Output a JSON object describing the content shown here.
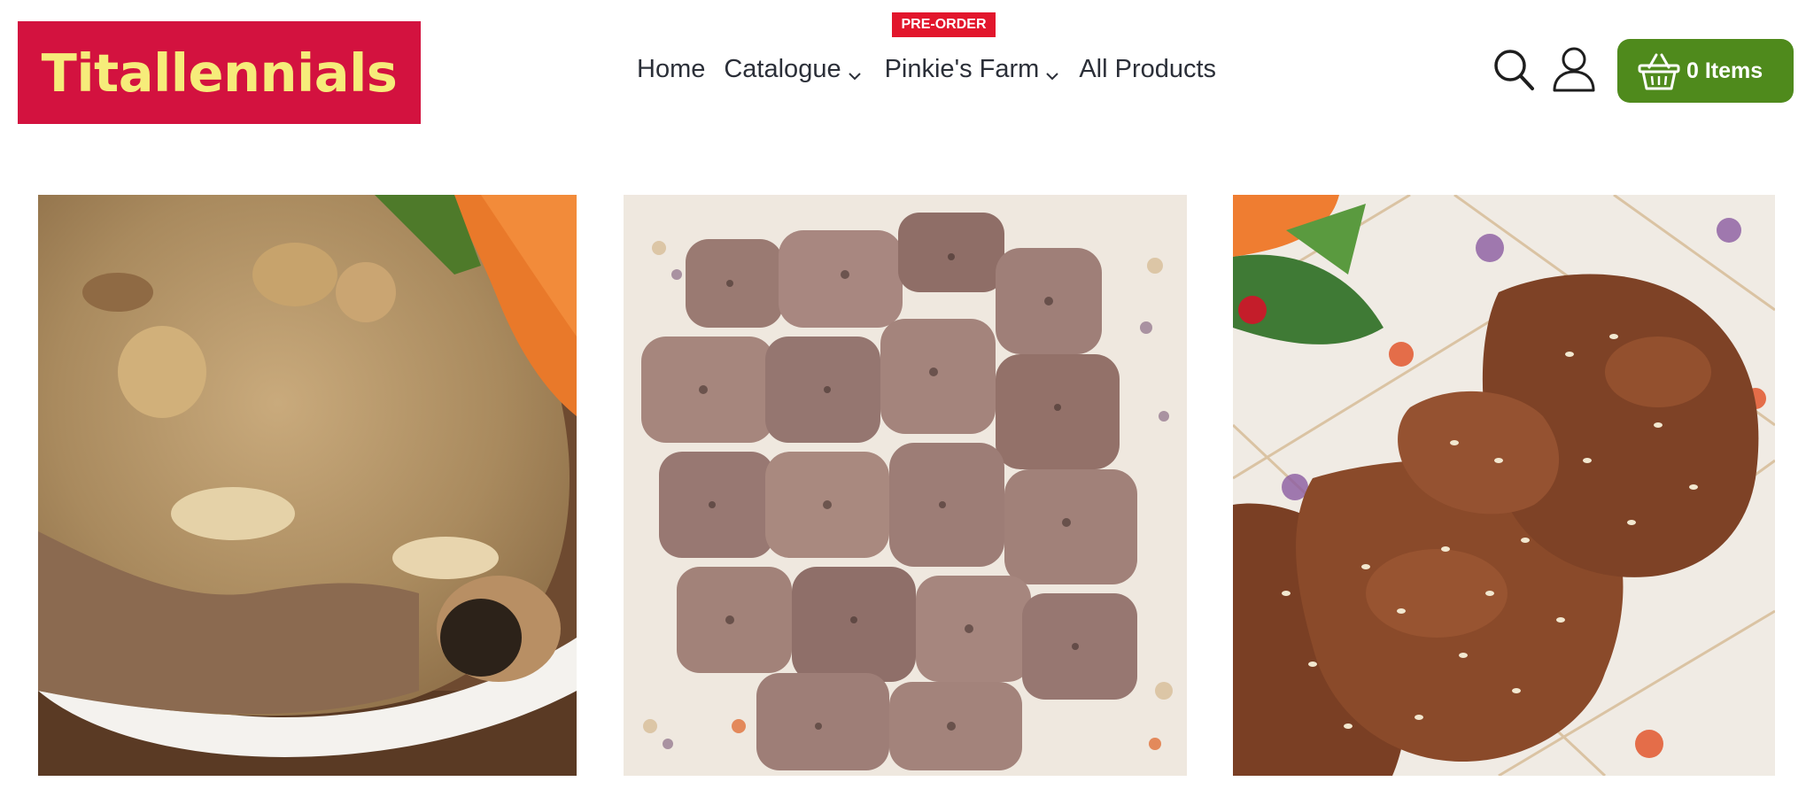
{
  "header": {
    "logo_text": "Titallennials",
    "nav": {
      "home": "Home",
      "catalogue": "Catalogue",
      "farm": "Pinkie's Farm",
      "all_products": "All Products"
    },
    "preorder_badge": "PRE-ORDER",
    "cart_label": "0 Items",
    "icons": {
      "search": "search-icon",
      "account": "user-icon",
      "cart": "basket-icon",
      "dropdown": "chevron-down-icon"
    }
  },
  "products": [
    {
      "image": "pork chop with mushroom gravy and carrots"
    },
    {
      "image": "grilled pork cubes with pepper on floral plate"
    },
    {
      "image": "sesame teriyaki pork on floral plate"
    }
  ],
  "colors": {
    "brand_red": "#d3123f",
    "logo_text": "#f6ec7a",
    "badge_red": "#e2162c",
    "cart_green": "#4f8a1c",
    "nav_text": "#2b2f38"
  }
}
